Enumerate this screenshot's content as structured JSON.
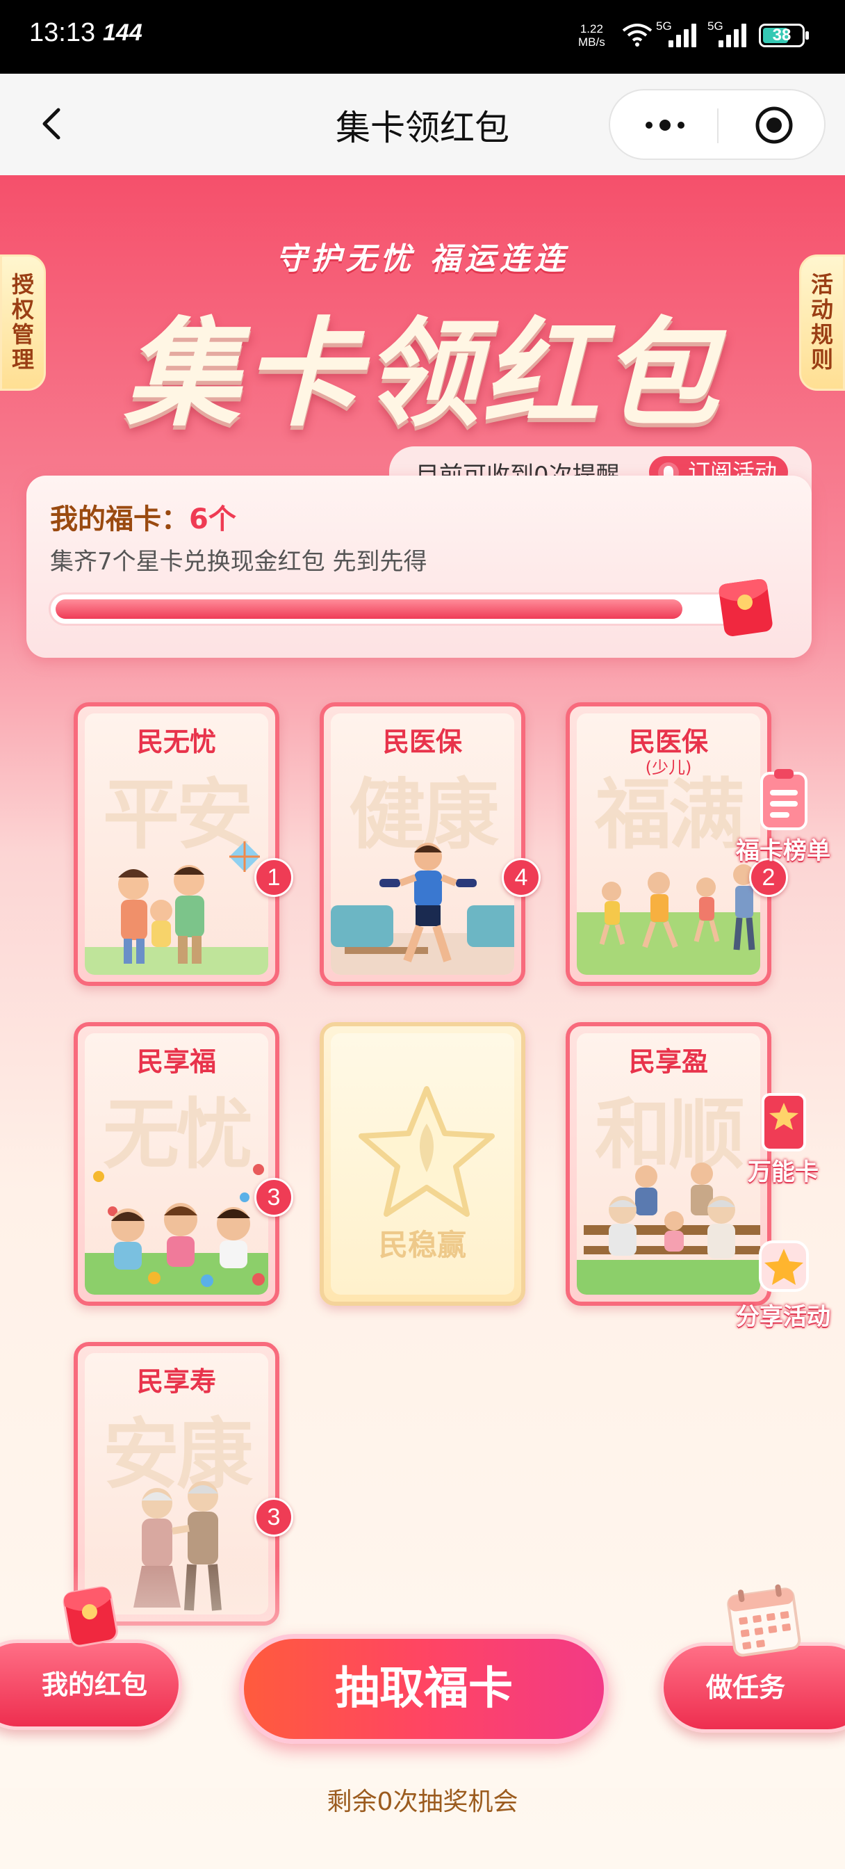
{
  "status_bar": {
    "time": "13:13",
    "refresh_rate": "144",
    "net_speed_value": "1.22",
    "net_speed_unit": "MB/s",
    "signal_1": "5G",
    "signal_2": "5G",
    "battery": "38"
  },
  "nav": {
    "title": "集卡领红包"
  },
  "side_tabs": {
    "left": "授权管理",
    "right": "活动规则"
  },
  "header": {
    "slogan": "守护无忧  福运连连",
    "title": "集卡领红包"
  },
  "summary": {
    "reminder_text": "目前可收到0次提醒",
    "subscribe_label": "订阅活动",
    "my_cards_label": "我的福卡：",
    "my_cards_count": "6个",
    "description": "集齐7个星卡兑换现金红包 先到先得",
    "progress_fraction": 0.92
  },
  "cards": [
    {
      "name": "民无忧",
      "watermark": "平安",
      "count": "1",
      "collected": true
    },
    {
      "name": "民医保",
      "watermark": "健康",
      "count": "4",
      "collected": true
    },
    {
      "name": "民医保",
      "subtitle": "(少儿)",
      "watermark": "福满",
      "count": "2",
      "collected": true
    },
    {
      "name": "民享福",
      "watermark": "无忧",
      "count": "3",
      "collected": true
    },
    {
      "name": "民稳赢",
      "collected": false
    },
    {
      "name": "民享盈",
      "watermark": "和顺",
      "collected": true
    },
    {
      "name": "民享寿",
      "watermark": "安康",
      "count": "3",
      "collected": true
    }
  ],
  "float_buttons": [
    "福卡榜单",
    "万能卡",
    "分享活动"
  ],
  "bottom": {
    "my_red_packet": "我的红包",
    "draw_card": "抽取福卡",
    "tasks": "做任务",
    "remaining": "剩余0次抽奖机会"
  },
  "colors": {
    "accent": "#ef3c55",
    "gold_text": "#9b5b1e"
  }
}
